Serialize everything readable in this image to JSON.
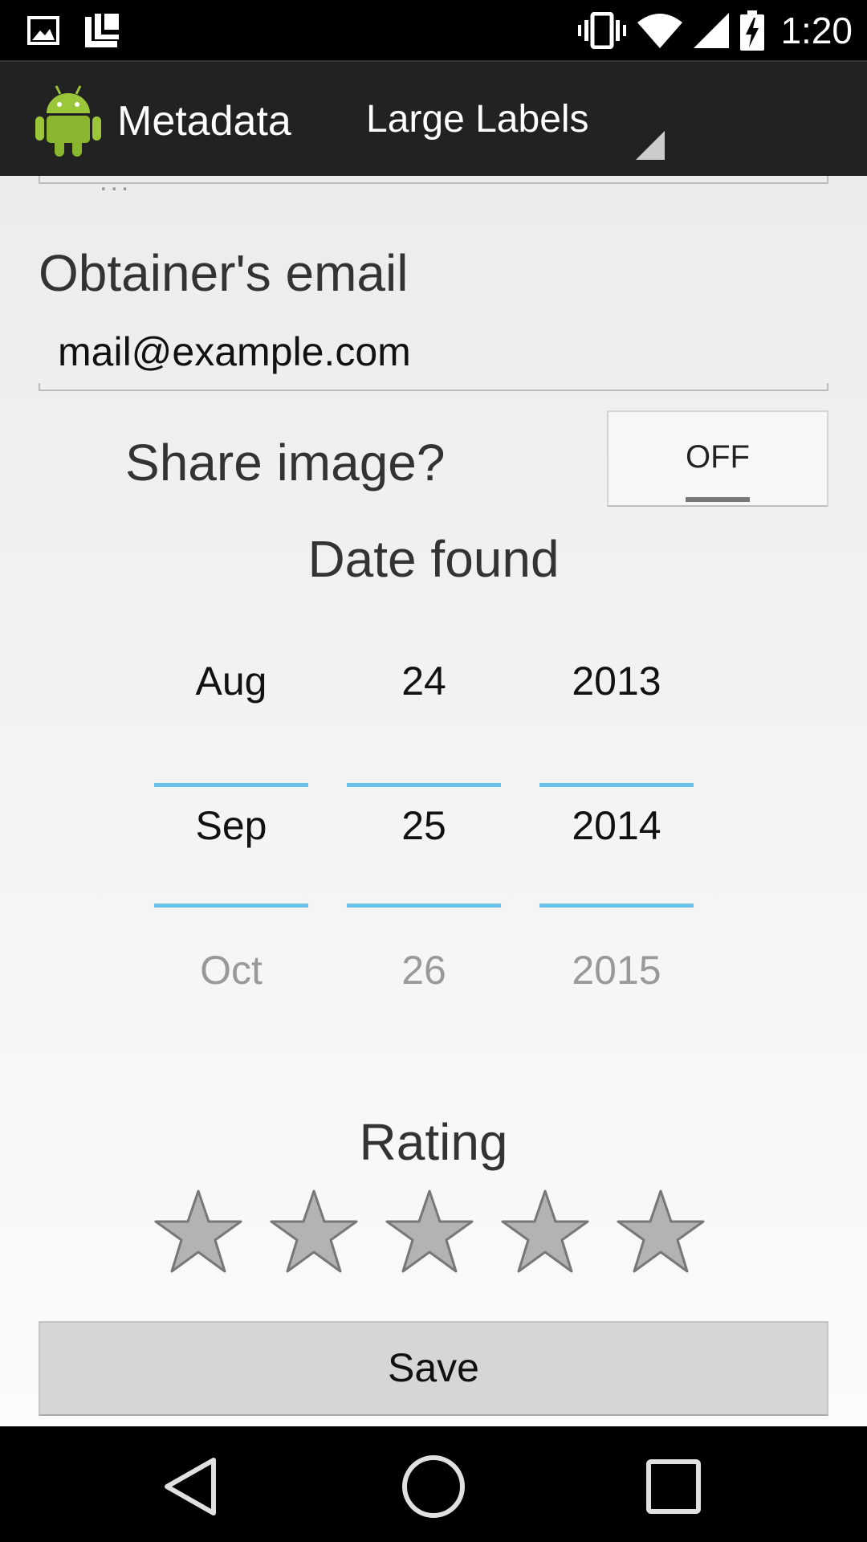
{
  "status_bar": {
    "time": "1:20",
    "icons": [
      "image-icon",
      "tasks-icon",
      "vibrate-icon",
      "wifi-icon",
      "signal-icon",
      "battery-charging-icon"
    ]
  },
  "action_bar": {
    "app_icon": "android-robot-icon",
    "title": "Metadata",
    "spinner_value": "Large Labels"
  },
  "form": {
    "previous_field_value": "...",
    "email_label": "Obtainer's email",
    "email_value": "mail@example.com",
    "share_label": "Share image?",
    "share_toggle": "OFF",
    "date_label": "Date found",
    "date_picker": {
      "month": {
        "prev": "Aug",
        "current": "Sep",
        "next": "Oct"
      },
      "day": {
        "prev": "24",
        "current": "25",
        "next": "26"
      },
      "year": {
        "prev": "2013",
        "current": "2014",
        "next": "2015"
      }
    },
    "rating_label": "Rating",
    "rating": {
      "value": 0,
      "max": 5
    },
    "save_label": "Save"
  },
  "nav_bar": {
    "icons": [
      "back-icon",
      "home-icon",
      "recents-icon"
    ]
  },
  "colors": {
    "picker_divider": "#6ac3e6",
    "action_bar": "#222222",
    "star_fill": "#b3b3b3"
  }
}
